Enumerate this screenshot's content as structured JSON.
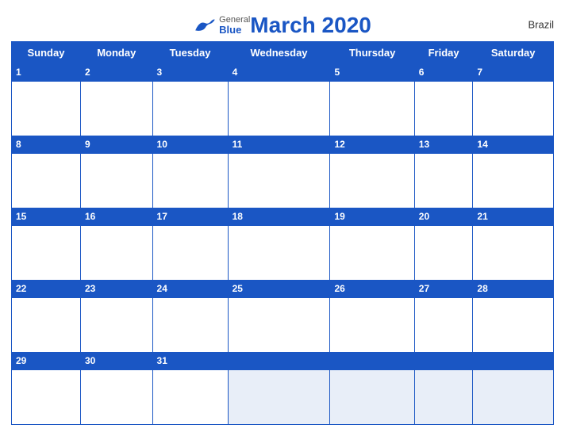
{
  "header": {
    "title": "March 2020",
    "country": "Brazil",
    "logo": {
      "general": "General",
      "blue": "Blue"
    }
  },
  "weekdays": [
    "Sunday",
    "Monday",
    "Tuesday",
    "Wednesday",
    "Thursday",
    "Friday",
    "Saturday"
  ],
  "weeks": [
    {
      "dates": [
        "1",
        "2",
        "3",
        "4",
        "5",
        "6",
        "7"
      ],
      "empty": [
        false,
        false,
        false,
        false,
        false,
        false,
        false
      ]
    },
    {
      "dates": [
        "8",
        "9",
        "10",
        "11",
        "12",
        "13",
        "14"
      ],
      "empty": [
        false,
        false,
        false,
        false,
        false,
        false,
        false
      ]
    },
    {
      "dates": [
        "15",
        "16",
        "17",
        "18",
        "19",
        "20",
        "21"
      ],
      "empty": [
        false,
        false,
        false,
        false,
        false,
        false,
        false
      ]
    },
    {
      "dates": [
        "22",
        "23",
        "24",
        "25",
        "26",
        "27",
        "28"
      ],
      "empty": [
        false,
        false,
        false,
        false,
        false,
        false,
        false
      ]
    },
    {
      "dates": [
        "29",
        "30",
        "31",
        "",
        "",
        "",
        ""
      ],
      "empty": [
        false,
        false,
        false,
        true,
        true,
        true,
        true
      ]
    }
  ],
  "colors": {
    "blue": "#1a56c4",
    "white": "#ffffff"
  }
}
